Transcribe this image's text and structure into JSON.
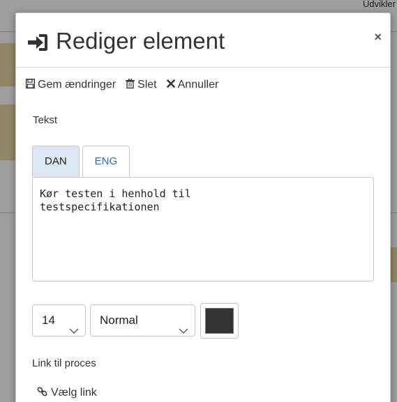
{
  "background": {
    "peek_text": "Udvikler"
  },
  "dialog": {
    "title": "Rediger element",
    "close_symbol": "×",
    "title_icon": "sign-in-icon"
  },
  "toolbar": {
    "save_label": "Gem ændringer",
    "delete_label": "Slet",
    "cancel_label": "Annuller",
    "save_icon": "floppy-disk-icon",
    "delete_icon": "trash-icon",
    "cancel_icon": "close-icon"
  },
  "text_section": {
    "label": "Tekst",
    "tabs": [
      {
        "label": "DAN",
        "active": true
      },
      {
        "label": "ENG",
        "active": false
      }
    ],
    "value": "Kør testen i henhold til\ntestspecifikationen"
  },
  "format": {
    "font_size": "14",
    "font_weight": "Normal",
    "color": "#333333"
  },
  "link_section": {
    "label": "Link til proces",
    "choose_label": "Vælg link",
    "choose_icon": "link-icon"
  },
  "colors": {
    "active_tab": "#dbe7f3",
    "inactive_tab_text": "#2a6fb5"
  }
}
